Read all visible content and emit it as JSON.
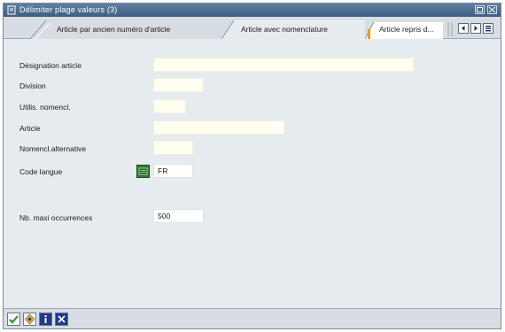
{
  "window": {
    "title": "Délimiter plage valeurs (3)"
  },
  "tabs": [
    {
      "label": "Article par ancien numéro d'article"
    },
    {
      "label": "Article avec nomenclature"
    },
    {
      "label": "Article repris d..."
    }
  ],
  "form": {
    "designation": {
      "label": "Désignation article",
      "value": ""
    },
    "division": {
      "label": "Division",
      "value": ""
    },
    "util_nomencl": {
      "label": "Utilis. nomencl.",
      "value": ""
    },
    "article": {
      "label": "Article",
      "value": ""
    },
    "nomencl_alt": {
      "label": "Nomencl.alternative",
      "value": ""
    },
    "code_langue": {
      "label": "Code langue",
      "value": "FR"
    },
    "nb_max": {
      "label": "Nb. maxi occurrences",
      "value": "500"
    }
  },
  "colors": {
    "titlebar": "#4a6b8f",
    "background": "#e6ebef",
    "input": "#fffff0"
  },
  "icons": [
    "window-icon",
    "minimize-icon",
    "close-icon",
    "tab-scroll-left-icon",
    "tab-scroll-right-icon",
    "tab-list-icon",
    "possible-entries-icon",
    "execute-checkmark-icon",
    "multiple-selection-icon",
    "info-icon",
    "cancel-icon"
  ]
}
